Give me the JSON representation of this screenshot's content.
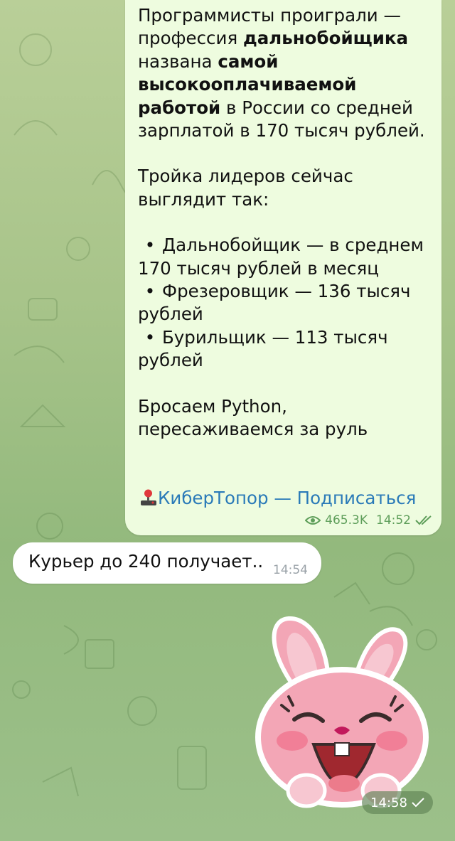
{
  "colors": {
    "outgoing_bubble": "#eefcdf",
    "incoming_bubble": "#ffffff",
    "link": "#2a7ab8",
    "outgoing_meta": "#5e9e5a",
    "background": "#a8c48a"
  },
  "outgoing_message": {
    "p1_a": "Программисты проиграли — профессия ",
    "p1_b": "дальнобойщика",
    "p1_c": " названа ",
    "p1_d": "самой высокооплачиваемой работой",
    "p1_e": " в России со средней зарплатой в 170 тысяч рублей.",
    "p2": "Тройка лидеров сейчас выглядит так:",
    "bullets": [
      "Дальнобойщик — в среднем 170 тысяч рублей в месяц",
      "Фрезеровщик — 136 тысяч рублей",
      "Бурильщик — 113 тысяч рублей"
    ],
    "p3": "Бросаем Python, пересаживаемся за руль",
    "channel_link": "КиберТопор — Подписаться",
    "views": "465.3K",
    "time": "14:52",
    "icons": {
      "views": "eye-icon",
      "status": "double-check-icon",
      "link": "joystick-icon"
    }
  },
  "incoming_message": {
    "text": "Курьер до 240 получает..",
    "time": "14:54"
  },
  "sticker": {
    "description_icon": "laughing-bunny-sticker",
    "time": "14:58",
    "status_icon": "check-icon"
  }
}
